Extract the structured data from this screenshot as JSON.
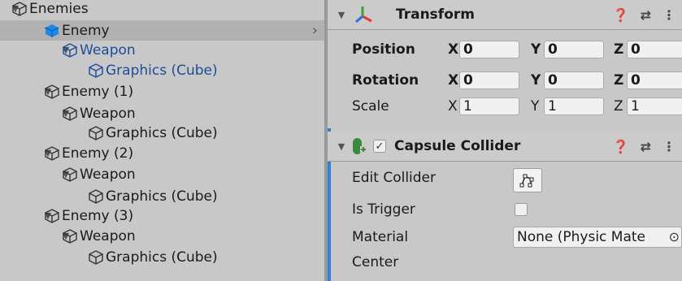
{
  "hierarchy": {
    "items": [
      {
        "label": "Enemies",
        "depth": 0,
        "icon": "cube-outline-icon",
        "prefab": false,
        "selected": false
      },
      {
        "label": "Enemy",
        "depth": 1,
        "icon": "prefab-cube-icon",
        "prefab": false,
        "selected": true
      },
      {
        "label": "Weapon",
        "depth": 2,
        "icon": "cube-outline-icon",
        "prefab": true,
        "selected": false
      },
      {
        "label": "Graphics (Cube)",
        "depth": 3,
        "icon": "cube-outline-icon",
        "prefab": true,
        "selected": false
      },
      {
        "label": "Enemy (1)",
        "depth": 1,
        "icon": "cube-outline-icon",
        "prefab": false,
        "selected": false
      },
      {
        "label": "Weapon",
        "depth": 2,
        "icon": "cube-outline-icon",
        "prefab": false,
        "selected": false
      },
      {
        "label": "Graphics (Cube)",
        "depth": 3,
        "icon": "cube-outline-icon",
        "prefab": false,
        "selected": false
      },
      {
        "label": "Enemy (2)",
        "depth": 1,
        "icon": "cube-outline-icon",
        "prefab": false,
        "selected": false
      },
      {
        "label": "Weapon",
        "depth": 2,
        "icon": "cube-outline-icon",
        "prefab": false,
        "selected": false
      },
      {
        "label": "Graphics (Cube)",
        "depth": 3,
        "icon": "cube-outline-icon",
        "prefab": false,
        "selected": false
      },
      {
        "label": "Enemy (3)",
        "depth": 1,
        "icon": "cube-outline-icon",
        "prefab": false,
        "selected": false
      },
      {
        "label": "Weapon",
        "depth": 2,
        "icon": "cube-outline-icon",
        "prefab": false,
        "selected": false
      },
      {
        "label": "Graphics (Cube)",
        "depth": 3,
        "icon": "cube-outline-icon",
        "prefab": false,
        "selected": false
      }
    ]
  },
  "inspector": {
    "transform": {
      "title": "Transform",
      "rows": [
        {
          "label": "Position",
          "x": "0",
          "y": "0",
          "z": "0",
          "bold": true
        },
        {
          "label": "Rotation",
          "x": "0",
          "y": "0",
          "z": "0",
          "bold": true
        },
        {
          "label": "Scale",
          "x": "1",
          "y": "1",
          "z": "1",
          "bold": false
        }
      ]
    },
    "collider": {
      "title": "Capsule Collider",
      "enabled_mark": "✓",
      "edit_label": "Edit Collider",
      "trigger_label": "Is Trigger",
      "material_label": "Material",
      "material_value": "None (Physic Mate",
      "center_label": "Center"
    },
    "axis_labels": {
      "x": "X",
      "y": "Y",
      "z": "Z"
    }
  },
  "colors": {
    "prefab_text": "#1b4d9a",
    "prefab_icon": "#1e88e5",
    "selection": "#b1b1b1",
    "accent": "#2f7fdb"
  }
}
